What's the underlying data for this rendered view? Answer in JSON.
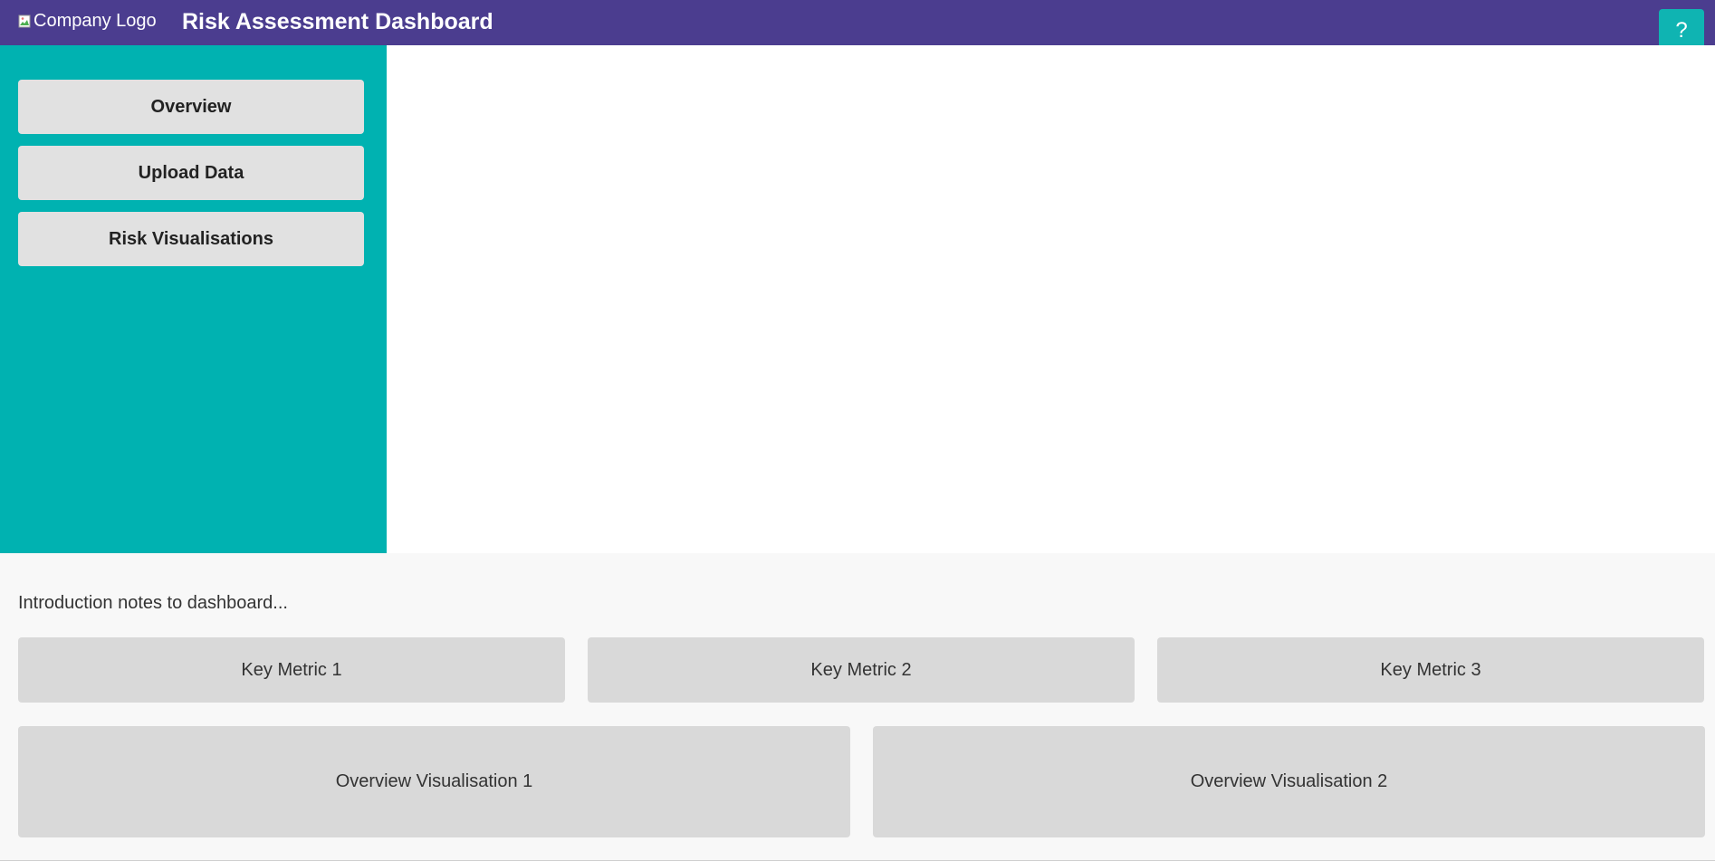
{
  "header": {
    "logo_alt": "Company Logo",
    "title": "Risk Assessment Dashboard",
    "help_label": "?"
  },
  "sidebar": {
    "items": [
      {
        "label": "Overview"
      },
      {
        "label": "Upload Data"
      },
      {
        "label": "Risk Visualisations"
      }
    ]
  },
  "overview": {
    "intro": "Introduction notes to dashboard...",
    "metrics": [
      {
        "label": "Key Metric 1"
      },
      {
        "label": "Key Metric 2"
      },
      {
        "label": "Key Metric 3"
      }
    ],
    "visualisations": [
      {
        "label": "Overview Visualisation 1"
      },
      {
        "label": "Overview Visualisation 2"
      }
    ]
  },
  "colors": {
    "header_bg": "#4b3d8f",
    "sidebar_bg": "#00b2b1",
    "help_bg": "#0fb4b2",
    "button_bg": "#e1e1e1",
    "card_bg": "#d9d9d9",
    "bottom_bg": "#f8f8f8"
  },
  "icons": {
    "logo": "broken-image-icon",
    "help": "question-mark-icon"
  }
}
